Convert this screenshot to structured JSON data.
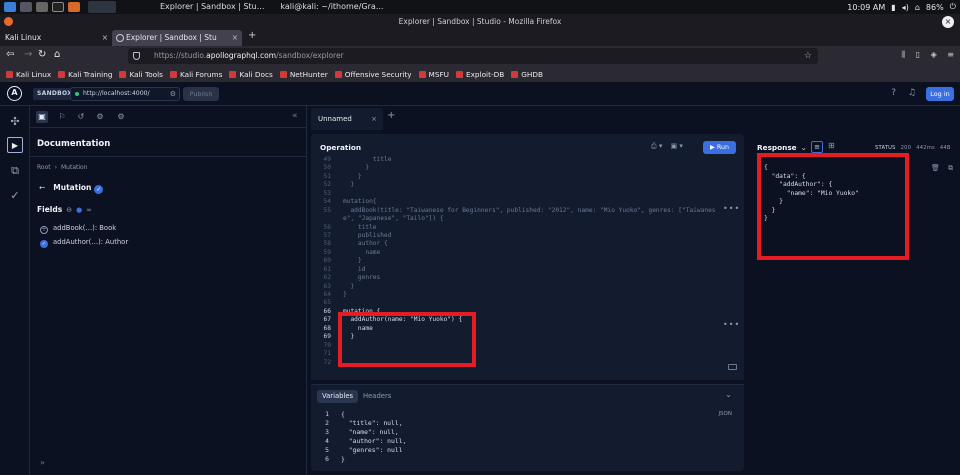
{
  "taskbar": {
    "windows": [
      "Explorer | Sandbox | Stu...",
      "kali@kali: ~/ithome/Gra..."
    ],
    "time": "10:09 AM",
    "battery": "86%"
  },
  "browser": {
    "window_title": "Explorer | Sandbox | Studio - Mozilla Firefox",
    "tabs": [
      {
        "label": "Kali Linux"
      },
      {
        "label": "Explorer | Sandbox | Stu"
      }
    ],
    "url_prefix": "https://studio.",
    "url_domain": "apollographql.com",
    "url_path": "/sandbox/explorer",
    "bookmarks": [
      "Kali Linux",
      "Kali Training",
      "Kali Tools",
      "Kali Forums",
      "Kali Docs",
      "NetHunter",
      "Offensive Security",
      "MSFU",
      "Exploit-DB",
      "GHDB"
    ]
  },
  "apollo": {
    "sandbox_label": "SANDBOX",
    "endpoint": "http://localhost:4000/",
    "publish_label": "Publish",
    "login_label": "Log in"
  },
  "docs": {
    "title": "Documentation",
    "breadcrumb": [
      "Root",
      "Mutation"
    ],
    "type_name": "Mutation",
    "fields_label": "Fields",
    "fields": [
      {
        "name": "addBook(…)",
        "type": "Book"
      },
      {
        "name": "addAuthor(…)",
        "type": "Author"
      }
    ]
  },
  "editor": {
    "tab_label": "Unnamed",
    "operation_label": "Operation",
    "run_label": "Run",
    "lines": [
      {
        "n": "49",
        "t": "        title"
      },
      {
        "n": "50",
        "t": "      }"
      },
      {
        "n": "51",
        "t": "    }"
      },
      {
        "n": "52",
        "t": "  }"
      },
      {
        "n": "53",
        "t": ""
      },
      {
        "n": "54",
        "t": "mutation{"
      },
      {
        "n": "55",
        "t": "  addBook(title: \"Taiwanese for Beginners\", published: \"2012\", name: \"Mio Yuoko\", genres: [\"Taiwanes"
      },
      {
        "n": "",
        "t": "e\", \"Japanese\", \"Tailo\"]) {"
      },
      {
        "n": "56",
        "t": "    title"
      },
      {
        "n": "57",
        "t": "    published"
      },
      {
        "n": "58",
        "t": "    author {"
      },
      {
        "n": "59",
        "t": "      name"
      },
      {
        "n": "60",
        "t": "    }"
      },
      {
        "n": "61",
        "t": "    id"
      },
      {
        "n": "62",
        "t": "    genres"
      },
      {
        "n": "63",
        "t": "  }"
      },
      {
        "n": "64",
        "t": "}"
      },
      {
        "n": "65",
        "t": ""
      },
      {
        "n": "66",
        "t": "mutation {"
      },
      {
        "n": "67",
        "t": "  addAuthor(name: \"Mio Yuoko\") {"
      },
      {
        "n": "68",
        "t": "    name"
      },
      {
        "n": "69",
        "t": "  }"
      },
      {
        "n": "70",
        "t": ""
      },
      {
        "n": "71",
        "t": ""
      },
      {
        "n": "72",
        "t": ""
      }
    ]
  },
  "variables": {
    "tab_label": "Variables",
    "headers_label": "Headers",
    "format_label": "JSON",
    "lines": [
      {
        "n": "1",
        "t": "{"
      },
      {
        "n": "2",
        "t": "  \"title\": null,"
      },
      {
        "n": "3",
        "t": "  \"name\": null,"
      },
      {
        "n": "4",
        "t": "  \"author\": null,"
      },
      {
        "n": "5",
        "t": "  \"genres\": null"
      },
      {
        "n": "6",
        "t": "}"
      }
    ]
  },
  "response": {
    "title": "Response",
    "status_label": "STATUS",
    "status_code": "200",
    "time": "442ms",
    "size": "44B",
    "lines": [
      "{",
      "  \"data\": {",
      "    \"addAuthor\": {",
      "      \"name\": \"Mio Yuoko\"",
      "    }",
      "  }",
      "}"
    ]
  }
}
